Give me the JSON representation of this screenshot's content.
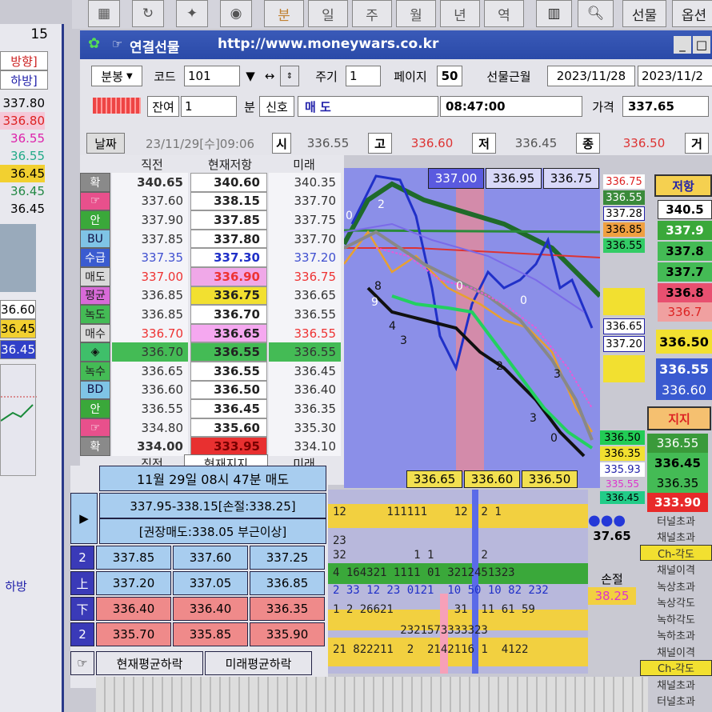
{
  "toolbar": {
    "tabs": [
      "분",
      "일",
      "주",
      "월",
      "년",
      "역"
    ],
    "right_buttons": [
      "선물",
      "옵션"
    ]
  },
  "left_panel": {
    "top_value": "15",
    "direction_label": "방향]",
    "direction_sub": "하방]",
    "prices": [
      "337.80",
      "336.80",
      "36.55",
      "36.55",
      "36.45",
      "36.45",
      "36.45"
    ],
    "prices_bottom": [
      "36.60",
      "36.45",
      "36.45"
    ],
    "bottom_label": "하방"
  },
  "window": {
    "title": "연결선물",
    "url": "http://www.moneywars.co.kr",
    "controls": [
      "_",
      "□"
    ]
  },
  "controls": {
    "period_select": "분봉",
    "code_label": "코드",
    "code_value": "101",
    "cycle_label": "주기",
    "cycle_value": "1",
    "page_label": "페이지",
    "page_value": "50",
    "symbol_name": "선물근월",
    "date1": "2023/11/28",
    "date2": "2023/11/2",
    "balance_label": "잔여",
    "balance_value": "1",
    "min_label": "분",
    "signal_label": "신호",
    "signal_value": "매 도",
    "time_value": "08:47:00",
    "price_label": "가격",
    "price_value": "337.65"
  },
  "quote_bar": {
    "date_btn": "날짜",
    "datetime": "23/11/29[수]09:06",
    "time_label": "시",
    "open": "336.55",
    "high_label": "고",
    "high": "336.60",
    "low_label": "저",
    "low": "336.45",
    "close_label": "종",
    "close": "336.50",
    "trade_label": "거"
  },
  "table": {
    "headers": [
      "직전",
      "현재저항",
      "미래"
    ],
    "footer_headers": [
      "직전",
      "현재지지",
      "미래"
    ],
    "rows": [
      {
        "label": "확",
        "c1": "340.65",
        "c2": "340.60",
        "c3": "340.35",
        "bg": "#8a8a8a",
        "fg": "#fff"
      },
      {
        "label": "☞",
        "c1": "337.60",
        "c2": "338.15",
        "c3": "337.70",
        "bg": "#e8508c",
        "fg": "#fff"
      },
      {
        "label": "안",
        "c1": "337.90",
        "c2": "337.85",
        "c3": "337.75",
        "bg": "#3aa83a",
        "fg": "#fff"
      },
      {
        "label": "BU",
        "c1": "337.85",
        "c2": "337.80",
        "c3": "337.70",
        "bg": "#7fc4e6",
        "fg": "#114"
      },
      {
        "label": "수급",
        "c1": "337.35",
        "c2": "337.30",
        "c3": "337.20",
        "bg": "#3a5bd0",
        "fg": "#fff"
      },
      {
        "label": "매도",
        "c1": "337.00",
        "c2": "336.90",
        "c3": "336.75",
        "bg": "#d9d9d9",
        "fg": "#222"
      },
      {
        "label": "평균",
        "c1": "336.85",
        "c2": "336.75",
        "c3": "336.65",
        "bg": "#d86ad8",
        "fg": "#222"
      },
      {
        "label": "녹도",
        "c1": "336.85",
        "c2": "336.70",
        "c3": "336.55",
        "bg": "#44bb55",
        "fg": "#222"
      },
      {
        "label": "매수",
        "c1": "336.70",
        "c2": "336.65",
        "c3": "336.55",
        "bg": "#d9d9d9",
        "fg": "#222"
      },
      {
        "label": "◈",
        "c1": "336.70",
        "c2": "336.55",
        "c3": "336.55",
        "bg": "#3fbf6a",
        "fg": "#111"
      },
      {
        "label": "녹수",
        "c1": "336.65",
        "c2": "336.55",
        "c3": "336.45",
        "bg": "#44bb55",
        "fg": "#222"
      },
      {
        "label": "BD",
        "c1": "336.60",
        "c2": "336.50",
        "c3": "336.40",
        "bg": "#7fc4e6",
        "fg": "#114"
      },
      {
        "label": "안",
        "c1": "336.55",
        "c2": "336.45",
        "c3": "336.35",
        "bg": "#3aa83a",
        "fg": "#fff"
      },
      {
        "label": "☞",
        "c1": "334.80",
        "c2": "335.60",
        "c3": "335.30",
        "bg": "#e8508c",
        "fg": "#fff"
      },
      {
        "label": "확",
        "c1": "334.00",
        "c2": "333.95",
        "c3": "334.10",
        "bg": "#8a8a8a",
        "fg": "#fff"
      }
    ]
  },
  "chart_top_labels": [
    "337.00",
    "336.95",
    "336.75"
  ],
  "chart_bottom_labels": [
    "336.65",
    "336.60",
    "336.50"
  ],
  "chart_right_tags": [
    "336.75",
    "336.55",
    "337.28",
    "336.85",
    "336.55",
    "336.65",
    "337.20",
    "336.50",
    "336.35",
    "335.93",
    "335.55",
    "336.45"
  ],
  "chart_digits": [
    "0",
    "2",
    "8",
    "9",
    "4",
    "3",
    "0",
    "0",
    "3",
    "2",
    "3",
    "0"
  ],
  "resistance_panel": {
    "title": "저항",
    "values": [
      "340.5",
      "337.9",
      "337.8",
      "337.7",
      "336.8",
      "336.7",
      "336.50",
      "336.55",
      "336.60"
    ]
  },
  "support_panel": {
    "title": "지지",
    "values": [
      "336.55",
      "336.45",
      "336.35",
      "333.90"
    ]
  },
  "signal_box": {
    "header": "11월 29일 08시 47분 매도",
    "line1": "337.95-338.15[손절:338.25]",
    "line2": "[권장매도:338.05 부근이상]",
    "rows": [
      {
        "label": "2",
        "v": [
          "337.85",
          "337.60",
          "337.25"
        ],
        "bg": "#a8cdef"
      },
      {
        "label": "上",
        "v": [
          "337.20",
          "337.05",
          "336.85"
        ],
        "bg": "#a8cdef"
      },
      {
        "label": "下",
        "v": [
          "336.40",
          "336.40",
          "336.35"
        ],
        "bg": "#ef8a8a"
      },
      {
        "label": "2",
        "v": [
          "335.70",
          "335.85",
          "335.90"
        ],
        "bg": "#ef8a8a"
      }
    ],
    "footer_left": "현재평균하락",
    "footer_right": "미래평균하락"
  },
  "lower_chart_rows": [
    "12      111111    12  2 1",
    "23",
    "32          1 1       2",
    "4 164321 1111 01 3212451323",
    "2 33 12 23 0121  10 50 10 82 232",
    "1 2 26621         31  11 61 59",
    "          2321573333323",
    "21 822211  2  2142116 1  4122"
  ],
  "side_panel": {
    "value": "37.65",
    "stoploss_label": "손절",
    "stoploss_value": "38.25",
    "items": [
      "터널초과",
      "채널초과",
      "Ch-각도",
      "채널이격",
      "녹상초과",
      "녹상각도",
      "녹하각도",
      "녹하초과",
      "채널이격",
      "Ch-각도",
      "채널초과",
      "터널초과"
    ]
  },
  "colors": {
    "chart_bg": "#8b8fe8",
    "resist_line": "#2a7a3a",
    "price_line": "#2030c8",
    "accent_green": "#22d060"
  }
}
